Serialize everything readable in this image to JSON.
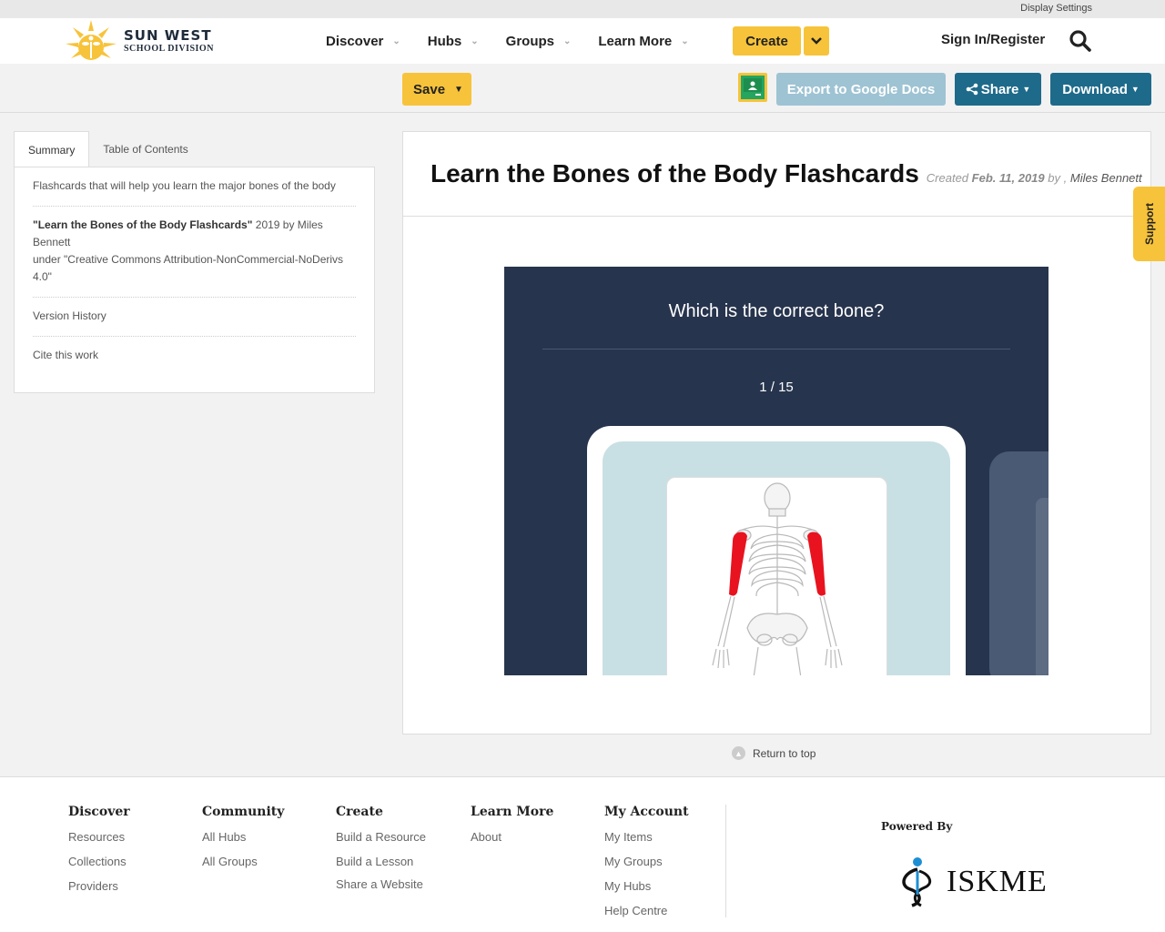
{
  "util_bar": {
    "display_settings": "Display Settings"
  },
  "header": {
    "logo_line1": "SUN WEST",
    "logo_line2": "SCHOOL DIVISION",
    "nav": [
      {
        "label": "Discover"
      },
      {
        "label": "Hubs"
      },
      {
        "label": "Groups"
      },
      {
        "label": "Learn More"
      }
    ],
    "create_label": "Create",
    "sign_in_label": "Sign In/Register"
  },
  "toolbar": {
    "save_label": "Save",
    "export_label": "Export to Google Docs",
    "share_label": "Share",
    "download_label": "Download"
  },
  "sidebar": {
    "tabs": [
      {
        "label": "Summary",
        "active": true
      },
      {
        "label": "Table of Contents",
        "active": false
      }
    ],
    "description": "Flashcards that will help you learn the major bones of the body",
    "license_title": "\"Learn the Bones of the Body Flashcards\"",
    "license_byline": " 2019 by Miles Bennett",
    "license_terms": "under \"Creative Commons Attribution-NonCommercial-NoDerivs 4.0\"",
    "version_history": "Version History",
    "cite": "Cite this work"
  },
  "resource": {
    "title": "Learn the Bones of the Body Flashcards",
    "created_prefix": "Created",
    "created_date": "Feb. 11, 2019",
    "by_text": "by ,",
    "author": "Miles Bennett"
  },
  "flashcard": {
    "question": "Which is the correct bone?",
    "counter": "1 / 15"
  },
  "support_label": "Support",
  "return_to_top": "Return to top",
  "footer": {
    "columns": [
      {
        "heading": "Discover",
        "links": [
          "Resources",
          "Collections",
          "Providers"
        ]
      },
      {
        "heading": "Community",
        "links": [
          "All Hubs",
          "All Groups"
        ]
      },
      {
        "heading": "Create",
        "links": [
          "Build a Resource",
          "Build a Lesson",
          "Share a Website"
        ]
      },
      {
        "heading": "Learn More",
        "links": [
          "About"
        ]
      },
      {
        "heading": "My Account",
        "links": [
          "My Items",
          "My Groups",
          "My Hubs",
          "Help Centre"
        ]
      }
    ],
    "powered_by": "Powered By",
    "iskme_text": "ISKME"
  },
  "colors": {
    "accent_yellow": "#f7c33a",
    "primary_blue": "#1e6a8a",
    "export_blue": "#9ec3d3",
    "flashcard_bg": "#27344d",
    "highlight_bone": "#e8131f"
  }
}
